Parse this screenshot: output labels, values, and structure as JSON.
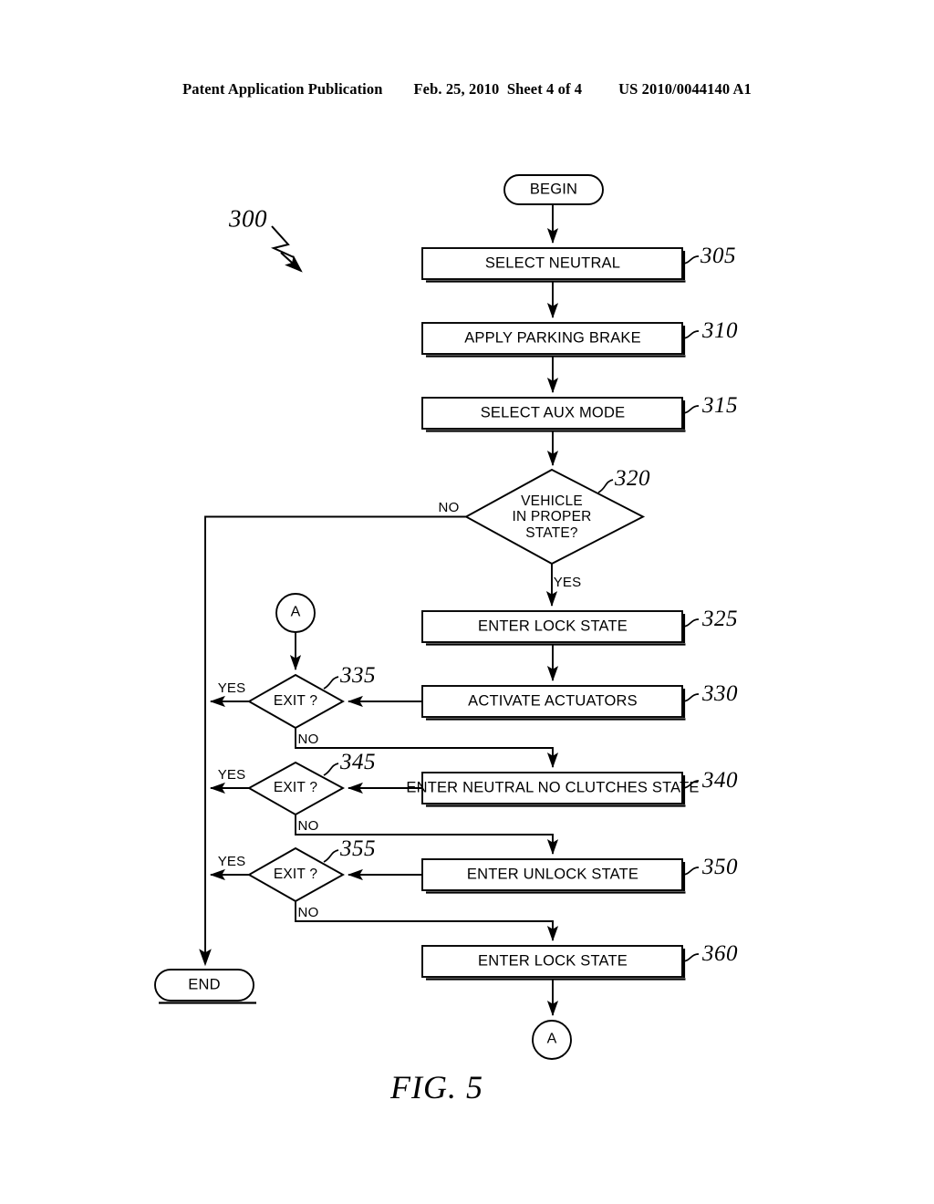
{
  "header": {
    "left": "Patent Application Publication",
    "middle": "Feb. 25, 2010  Sheet 4 of 4",
    "right": "US 2010/0044140 A1"
  },
  "figure": {
    "caption": "FIG. 5",
    "diagram_id": "300",
    "stroke_color": "#000000",
    "background_color": "#ffffff"
  },
  "terminals": [
    {
      "id": "begin",
      "label": "BEGIN"
    },
    {
      "id": "end",
      "label": "END"
    }
  ],
  "connectors": [
    {
      "id": "conn-a-top",
      "label": "A"
    },
    {
      "id": "conn-a-bottom",
      "label": "A"
    }
  ],
  "process_steps": [
    {
      "ref": "305",
      "label": "SELECT NEUTRAL"
    },
    {
      "ref": "310",
      "label": "APPLY PARKING BRAKE"
    },
    {
      "ref": "315",
      "label": "SELECT AUX MODE"
    },
    {
      "ref": "325",
      "label": "ENTER LOCK STATE"
    },
    {
      "ref": "330",
      "label": "ACTIVATE ACTUATORS"
    },
    {
      "ref": "340",
      "label": "ENTER NEUTRAL NO CLUTCHES STATE"
    },
    {
      "ref": "350",
      "label": "ENTER UNLOCK STATE"
    },
    {
      "ref": "360",
      "label": "ENTER LOCK STATE"
    }
  ],
  "decisions": [
    {
      "ref": "320",
      "line1": "VEHICLE",
      "line2": "IN PROPER",
      "line3": "STATE?",
      "yes_label": "YES",
      "no_label": "NO"
    },
    {
      "ref": "335",
      "label": "EXIT ?",
      "yes_label": "YES",
      "no_label": "NO"
    },
    {
      "ref": "345",
      "label": "EXIT ?",
      "yes_label": "YES",
      "no_label": "NO"
    },
    {
      "ref": "355",
      "label": "EXIT ?",
      "yes_label": "YES",
      "no_label": "NO"
    }
  ]
}
